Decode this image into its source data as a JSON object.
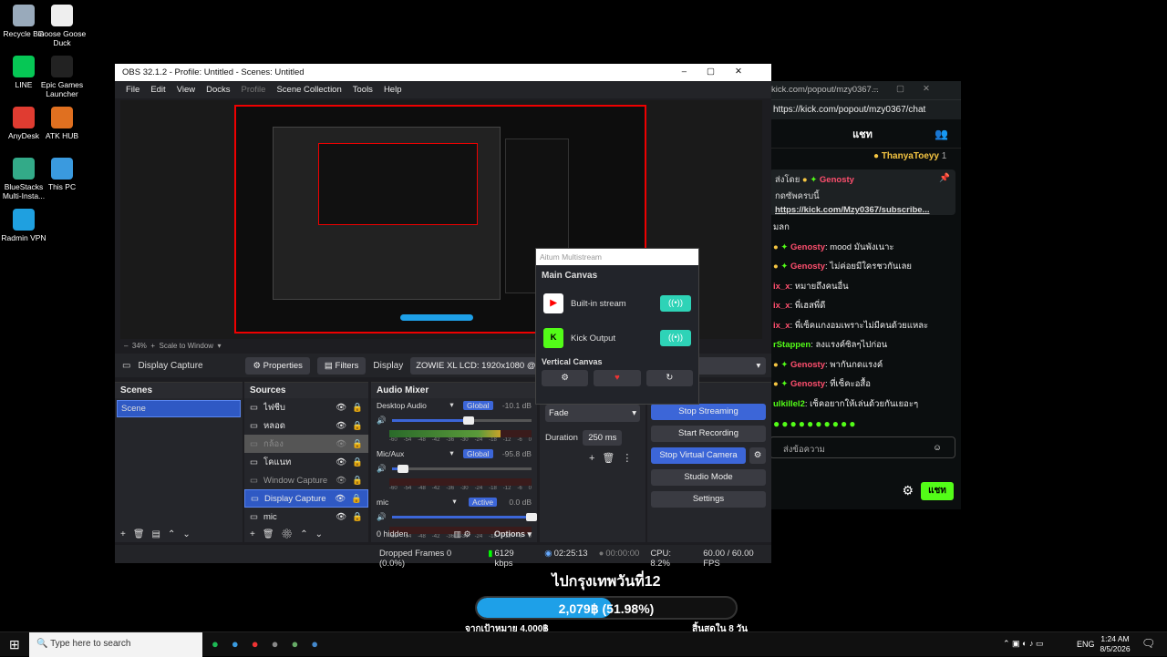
{
  "desktop": {
    "icons": [
      {
        "label": "Recycle Bin",
        "color": "#9ab"
      },
      {
        "label": "Goose Goose Duck",
        "color": "#eee"
      },
      {
        "label": "LINE",
        "color": "#06c755"
      },
      {
        "label": "Epic Games Launcher",
        "color": "#222"
      },
      {
        "label": "AnyDesk",
        "color": "#e03c31"
      },
      {
        "label": "ATK HUB",
        "color": "#e07020"
      },
      {
        "label": "BlueStacks Multi-Insta...",
        "color": "#3a8"
      },
      {
        "label": "This PC",
        "color": "#3a9adf"
      },
      {
        "label": "Radmin VPN",
        "color": "#1fa0e0"
      }
    ]
  },
  "kick": {
    "window_title": "kick.com/popout/mzy0367...",
    "url": "https://kick.com/popout/mzy0367/chat",
    "tab_chat": "แชท",
    "pinned_user": "ThanyaToeyy",
    "pinned_count": "1",
    "pinned_prefix": "ส่งโดย",
    "pinned_by": "Genosty",
    "pinned_text": "กดซัพครบนี้",
    "pinned_link": "https://kick.com/Mzy0367/subscribe...",
    "messages": [
      {
        "user": "",
        "text": "มลก",
        "color": "#eee"
      },
      {
        "user": "Genosty",
        "text": ": mood มันพังเนาะ",
        "color": "#ff4f6e"
      },
      {
        "user": "Genosty",
        "text": ": ไม่ค่อยมีใครชวกันเลย",
        "color": "#ff4f6e"
      },
      {
        "user": "ix_x",
        "text": ": หมายถึงคนอื่น",
        "color": "#ff4f6e"
      },
      {
        "user": "ix_x",
        "text": ": พี่เฮสพี่ดี",
        "color": "#ff4f6e"
      },
      {
        "user": "ix_x",
        "text": ": พี่เซ็คแกงอมเพราะไม่มีคนด้วยแหละ",
        "color": "#ff4f6e"
      },
      {
        "user": "rStappen",
        "text": ": ลงแรงค์ซิลๆไปก่อน",
        "color": "#53fc18"
      },
      {
        "user": "Genosty",
        "text": ": พากันกดแรงค์",
        "color": "#ff4f6e"
      },
      {
        "user": "Genosty",
        "text": ": ที่เซ็คะอสื้อ",
        "color": "#ff4f6e"
      },
      {
        "user": "ulkillel2",
        "text": ": เซ็คอยากให้เล่นด้วยกันเยอะๆ",
        "color": "#53fc18"
      }
    ],
    "input_placeholder": "ส่งข้อความ",
    "send_label": "แชท"
  },
  "obs": {
    "title": "OBS 32.1.2 - Profile: Untitled - Scenes: Untitled",
    "menu": [
      "File",
      "Edit",
      "View",
      "Docks",
      "Profile",
      "Scene Collection",
      "Tools",
      "Help"
    ],
    "zoom": "34%",
    "scale_label": "Scale to Window",
    "source_bar": {
      "name": "Display Capture",
      "properties": "Properties",
      "filters": "Filters",
      "display_label": "Display",
      "display_value": "ZOWIE XL LCD: 1920x1080 @ 0,0 (Pr"
    },
    "scenes": {
      "title": "Scenes",
      "items": [
        "Scene"
      ]
    },
    "sources": {
      "title": "Sources",
      "items": [
        "ไฟชีบ",
        "หลอด",
        "กล้อง",
        "โคแนท",
        "Window Capture",
        "Display Capture",
        "mic"
      ]
    },
    "mixer": {
      "title": "Audio Mixer",
      "channels": [
        {
          "name": "Desktop Audio",
          "badge": "Global",
          "db": "-10.1 dB",
          "level": 0.55
        },
        {
          "name": "Mic/Aux",
          "badge": "Global",
          "db": "-95.8 dB",
          "level": 0.08
        },
        {
          "name": "mic",
          "badge": "Active",
          "db": "0.0 dB",
          "level": 1.0
        }
      ],
      "ticks": [
        "-60",
        "-54",
        "-48",
        "-42",
        "-36",
        "-30",
        "-24",
        "-18",
        "-12",
        "-6",
        "0"
      ],
      "hidden": "0 hidden",
      "options": "Options"
    },
    "transitions": {
      "type": "Fade",
      "duration_label": "Duration",
      "duration": "250 ms"
    },
    "controls": {
      "stop_streaming": "Stop Streaming",
      "start_recording": "Start Recording",
      "stop_virtual": "Stop Virtual Camera",
      "studio": "Studio Mode",
      "settings": "Settings"
    },
    "status": {
      "dropped": "Dropped Frames 0 (0.0%)",
      "kbps": "6129 kbps",
      "stream_time": "02:25:13",
      "rec_time": "00:00:00",
      "cpu": "CPU: 8.2%",
      "fps": "60.00 / 60.00 FPS"
    }
  },
  "multistream": {
    "title": "Aitum Multistream",
    "main_canvas": "Main Canvas",
    "outputs": [
      "Built-in stream",
      "Kick Output"
    ],
    "vertical": "Vertical Canvas"
  },
  "donation": {
    "title": "ไปกรุงเทพวันที่12",
    "amount": "2,079฿ (51.98%)",
    "progress": 0.5198,
    "goal": "จากเป้าหมาย 4,000฿",
    "remaining": "สิ้นสุดใน 8 วัน"
  },
  "taskbar": {
    "search_placeholder": "Type here to search",
    "lang": "ENG",
    "time": "1:24 AM",
    "date": "8/5/2026"
  }
}
